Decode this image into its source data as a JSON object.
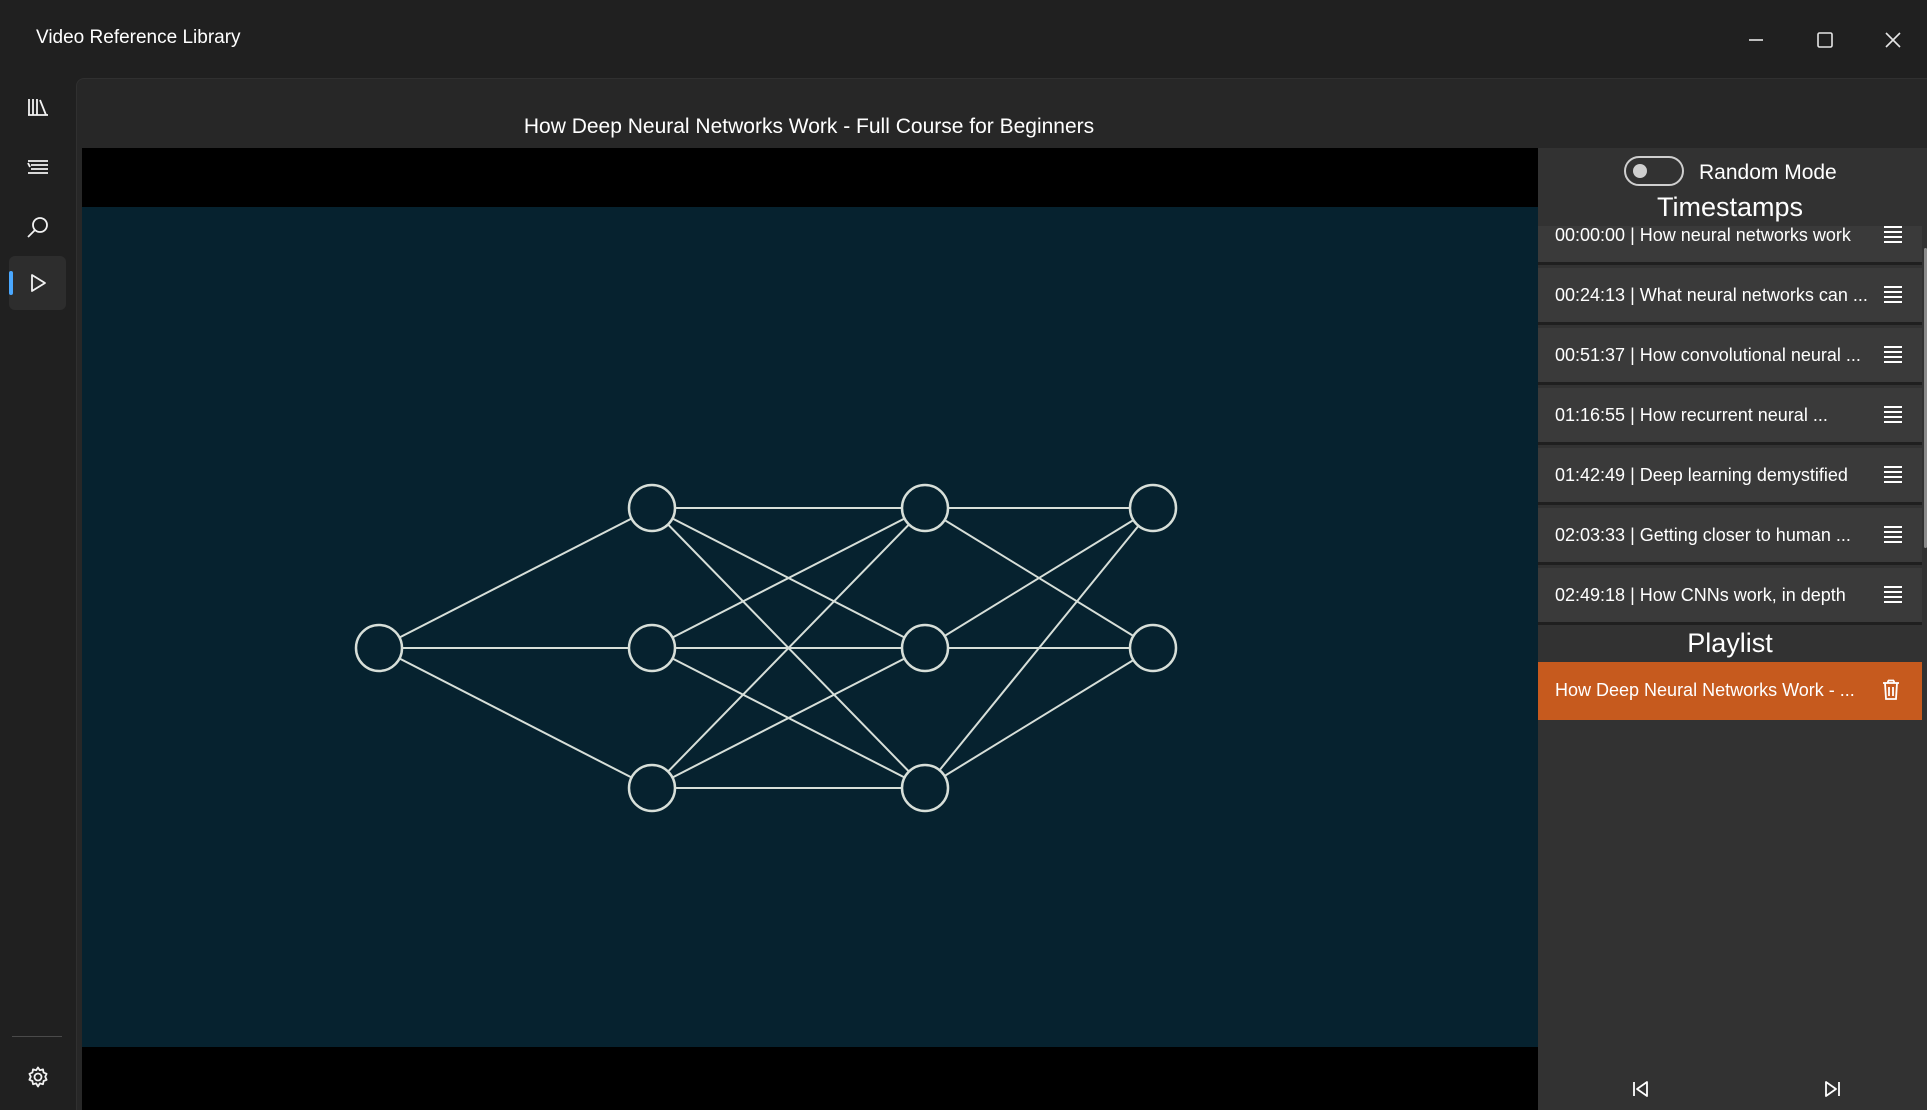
{
  "window": {
    "title": "Video Reference Library",
    "controls": [
      "minimize-icon",
      "maximize-icon",
      "close-icon"
    ]
  },
  "nav": {
    "items": [
      {
        "id": "library",
        "icon": "library-icon"
      },
      {
        "id": "list",
        "icon": "list-icon"
      },
      {
        "id": "search",
        "icon": "search-icon"
      },
      {
        "id": "player",
        "icon": "play-icon",
        "active": true
      }
    ],
    "footer": {
      "id": "settings",
      "icon": "gear-icon"
    }
  },
  "video": {
    "title": "How Deep Neural Networks Work - Full Course for Beginners"
  },
  "side_panel": {
    "random_mode_label": "Random Mode",
    "random_mode_on": false,
    "timestamps_header": "Timestamps",
    "timestamps": [
      {
        "text": "00:00:00 | How neural networks work"
      },
      {
        "text": "00:24:13 | What neural networks can ..."
      },
      {
        "text": "00:51:37 | How convolutional neural ..."
      },
      {
        "text": "01:16:55 | How recurrent neural ..."
      },
      {
        "text": "01:42:49 | Deep learning demystified"
      },
      {
        "text": "02:03:33 | Getting closer to human ..."
      },
      {
        "text": "02:49:18 | How CNNs work, in depth"
      }
    ],
    "playlist_header": "Playlist",
    "playlist": [
      {
        "text": "How Deep Neural Networks Work - ...",
        "selected": true
      }
    ]
  },
  "colors": {
    "accent": "#c65a1e",
    "nav_indicator": "#4aa8ff",
    "video_background": "#06222f",
    "network_lines": "#d7dfd9"
  }
}
